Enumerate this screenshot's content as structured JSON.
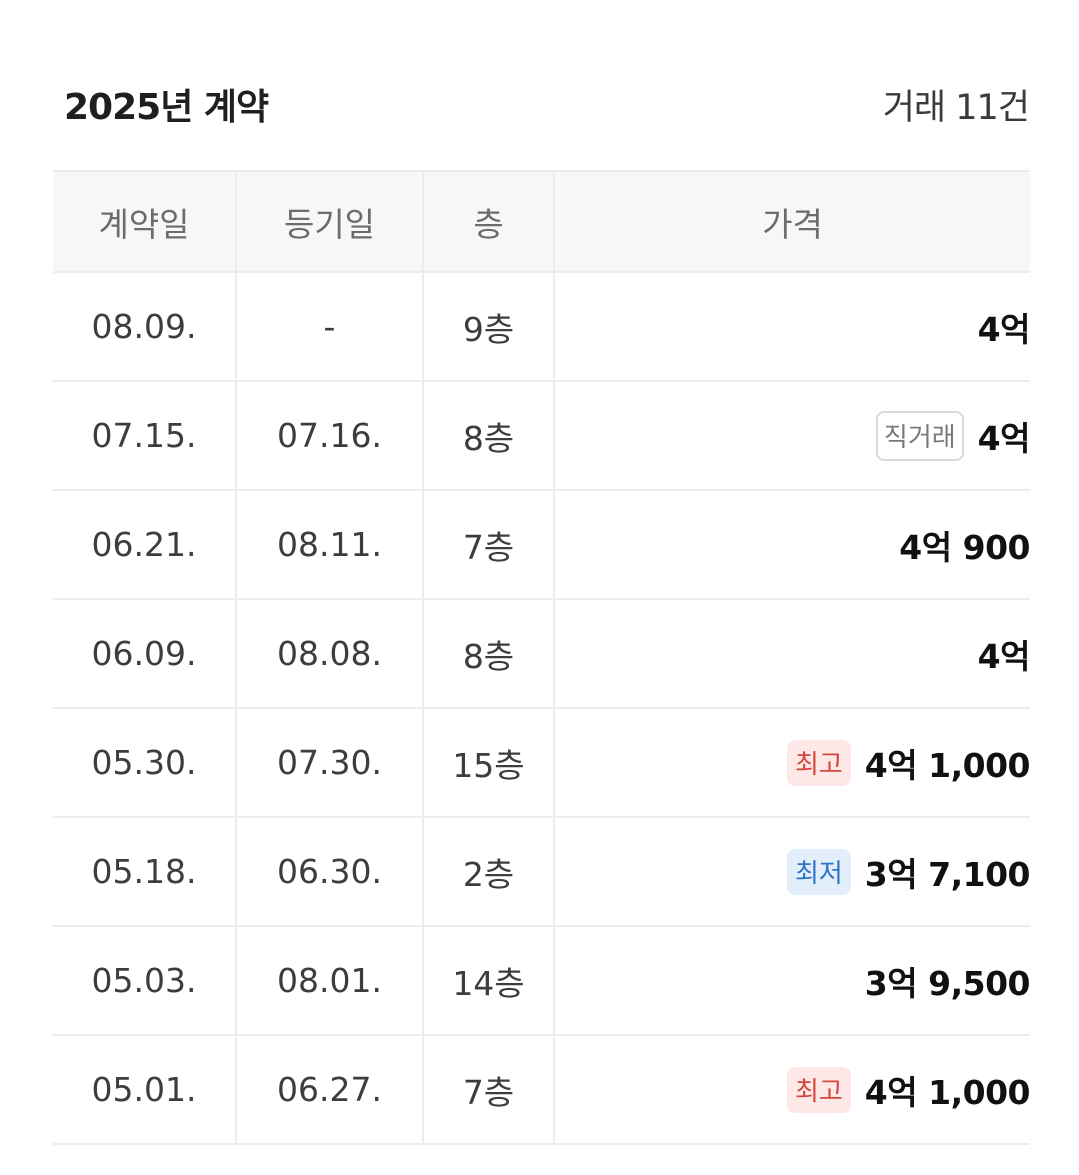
{
  "header": {
    "title": "2025년 계약",
    "count": "거래 11건"
  },
  "table": {
    "columns": [
      "계약일",
      "등기일",
      "층",
      "가격"
    ],
    "rows": [
      {
        "contract_date": "08.09.",
        "registry_date": "-",
        "floor": "9층",
        "price": "4억",
        "badge": null,
        "badge_type": null
      },
      {
        "contract_date": "07.15.",
        "registry_date": "07.16.",
        "floor": "8층",
        "price": "4억",
        "badge": "직거래",
        "badge_type": "direct"
      },
      {
        "contract_date": "06.21.",
        "registry_date": "08.11.",
        "floor": "7층",
        "price": "4억 900",
        "badge": null,
        "badge_type": null
      },
      {
        "contract_date": "06.09.",
        "registry_date": "08.08.",
        "floor": "8층",
        "price": "4억",
        "badge": null,
        "badge_type": null
      },
      {
        "contract_date": "05.30.",
        "registry_date": "07.30.",
        "floor": "15층",
        "price": "4억 1,000",
        "badge": "최고",
        "badge_type": "high"
      },
      {
        "contract_date": "05.18.",
        "registry_date": "06.30.",
        "floor": "2층",
        "price": "3억 7,100",
        "badge": "최저",
        "badge_type": "low"
      },
      {
        "contract_date": "05.03.",
        "registry_date": "08.01.",
        "floor": "14층",
        "price": "3억 9,500",
        "badge": null,
        "badge_type": null
      },
      {
        "contract_date": "05.01.",
        "registry_date": "06.27.",
        "floor": "7층",
        "price": "4억 1,000",
        "badge": "최고",
        "badge_type": "high"
      }
    ]
  },
  "colors": {
    "high_badge_text": "#d2483f",
    "high_badge_bg": "#fde7e7",
    "low_badge_text": "#2f74c9",
    "low_badge_bg": "#e3eefb"
  }
}
